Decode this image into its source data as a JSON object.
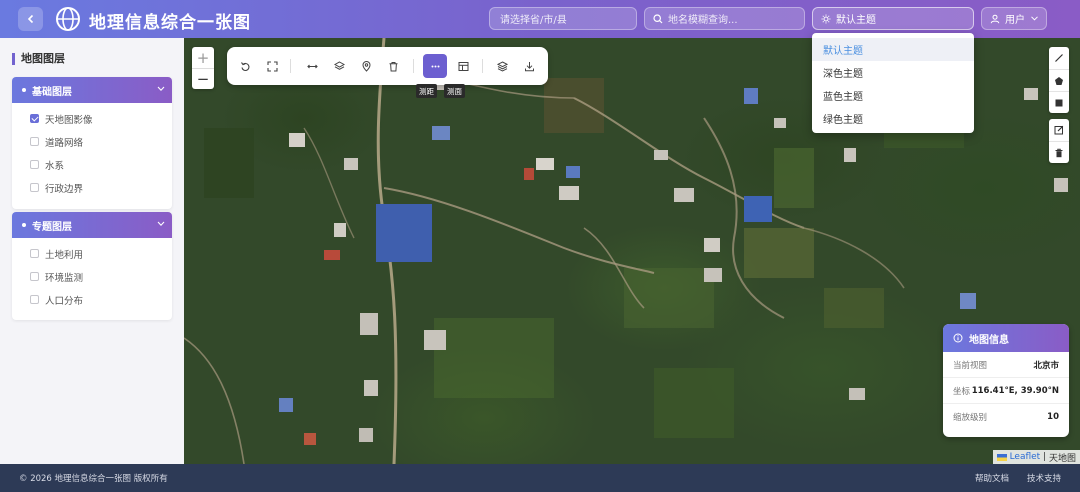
{
  "header": {
    "title": "地理信息综合一张图",
    "region_placeholder": "请选择省/市/县",
    "search_placeholder": "地名模糊查询...",
    "theme_selected": "默认主题",
    "user_label": "用户"
  },
  "sidebar": {
    "title": "地图图层",
    "groups": [
      {
        "title": "基础图层",
        "items": [
          {
            "label": "天地图影像",
            "checked": true
          },
          {
            "label": "道路网络",
            "checked": false
          },
          {
            "label": "水系",
            "checked": false
          },
          {
            "label": "行政边界",
            "checked": false
          }
        ]
      },
      {
        "title": "专题图层",
        "items": [
          {
            "label": "土地利用",
            "checked": false
          },
          {
            "label": "环境监测",
            "checked": false
          },
          {
            "label": "人口分布",
            "checked": false
          }
        ]
      }
    ]
  },
  "map": {
    "zoom_in": "+",
    "zoom_out": "−",
    "toolbar_tooltips": {
      "measure_distance": "测距",
      "measure_area": "测面"
    },
    "toolbar_icons": [
      "undo-icon",
      "fullscreen-icon",
      "measure-distance-icon",
      "layers-icon",
      "location-pin-icon",
      "trash-icon",
      "more-dots-icon",
      "table-icon",
      "stack-icon",
      "download-icon"
    ],
    "theme_options": [
      "默认主题",
      "深色主题",
      "蓝色主题",
      "绿色主题"
    ],
    "info_panel": {
      "title": "地图信息",
      "rows": [
        {
          "label": "当前视图",
          "value": "北京市"
        },
        {
          "label": "坐标",
          "value": "116.41°E, 39.90°N"
        },
        {
          "label": "缩放级别",
          "value": "10"
        }
      ]
    },
    "attribution": {
      "leaflet": "Leaflet",
      "separator": " | ",
      "provider": "天地图"
    }
  },
  "footer": {
    "copyright": "© 2026 地理信息综合一张图 版权所有",
    "links": [
      "帮助文档",
      "技术支持"
    ]
  },
  "colors": {
    "accent": "#6c5fd0",
    "header_start": "#6a7ae0",
    "header_end": "#8a5cc6",
    "footer_bg": "#2d3a56",
    "selected_text": "#4a8fe0"
  }
}
